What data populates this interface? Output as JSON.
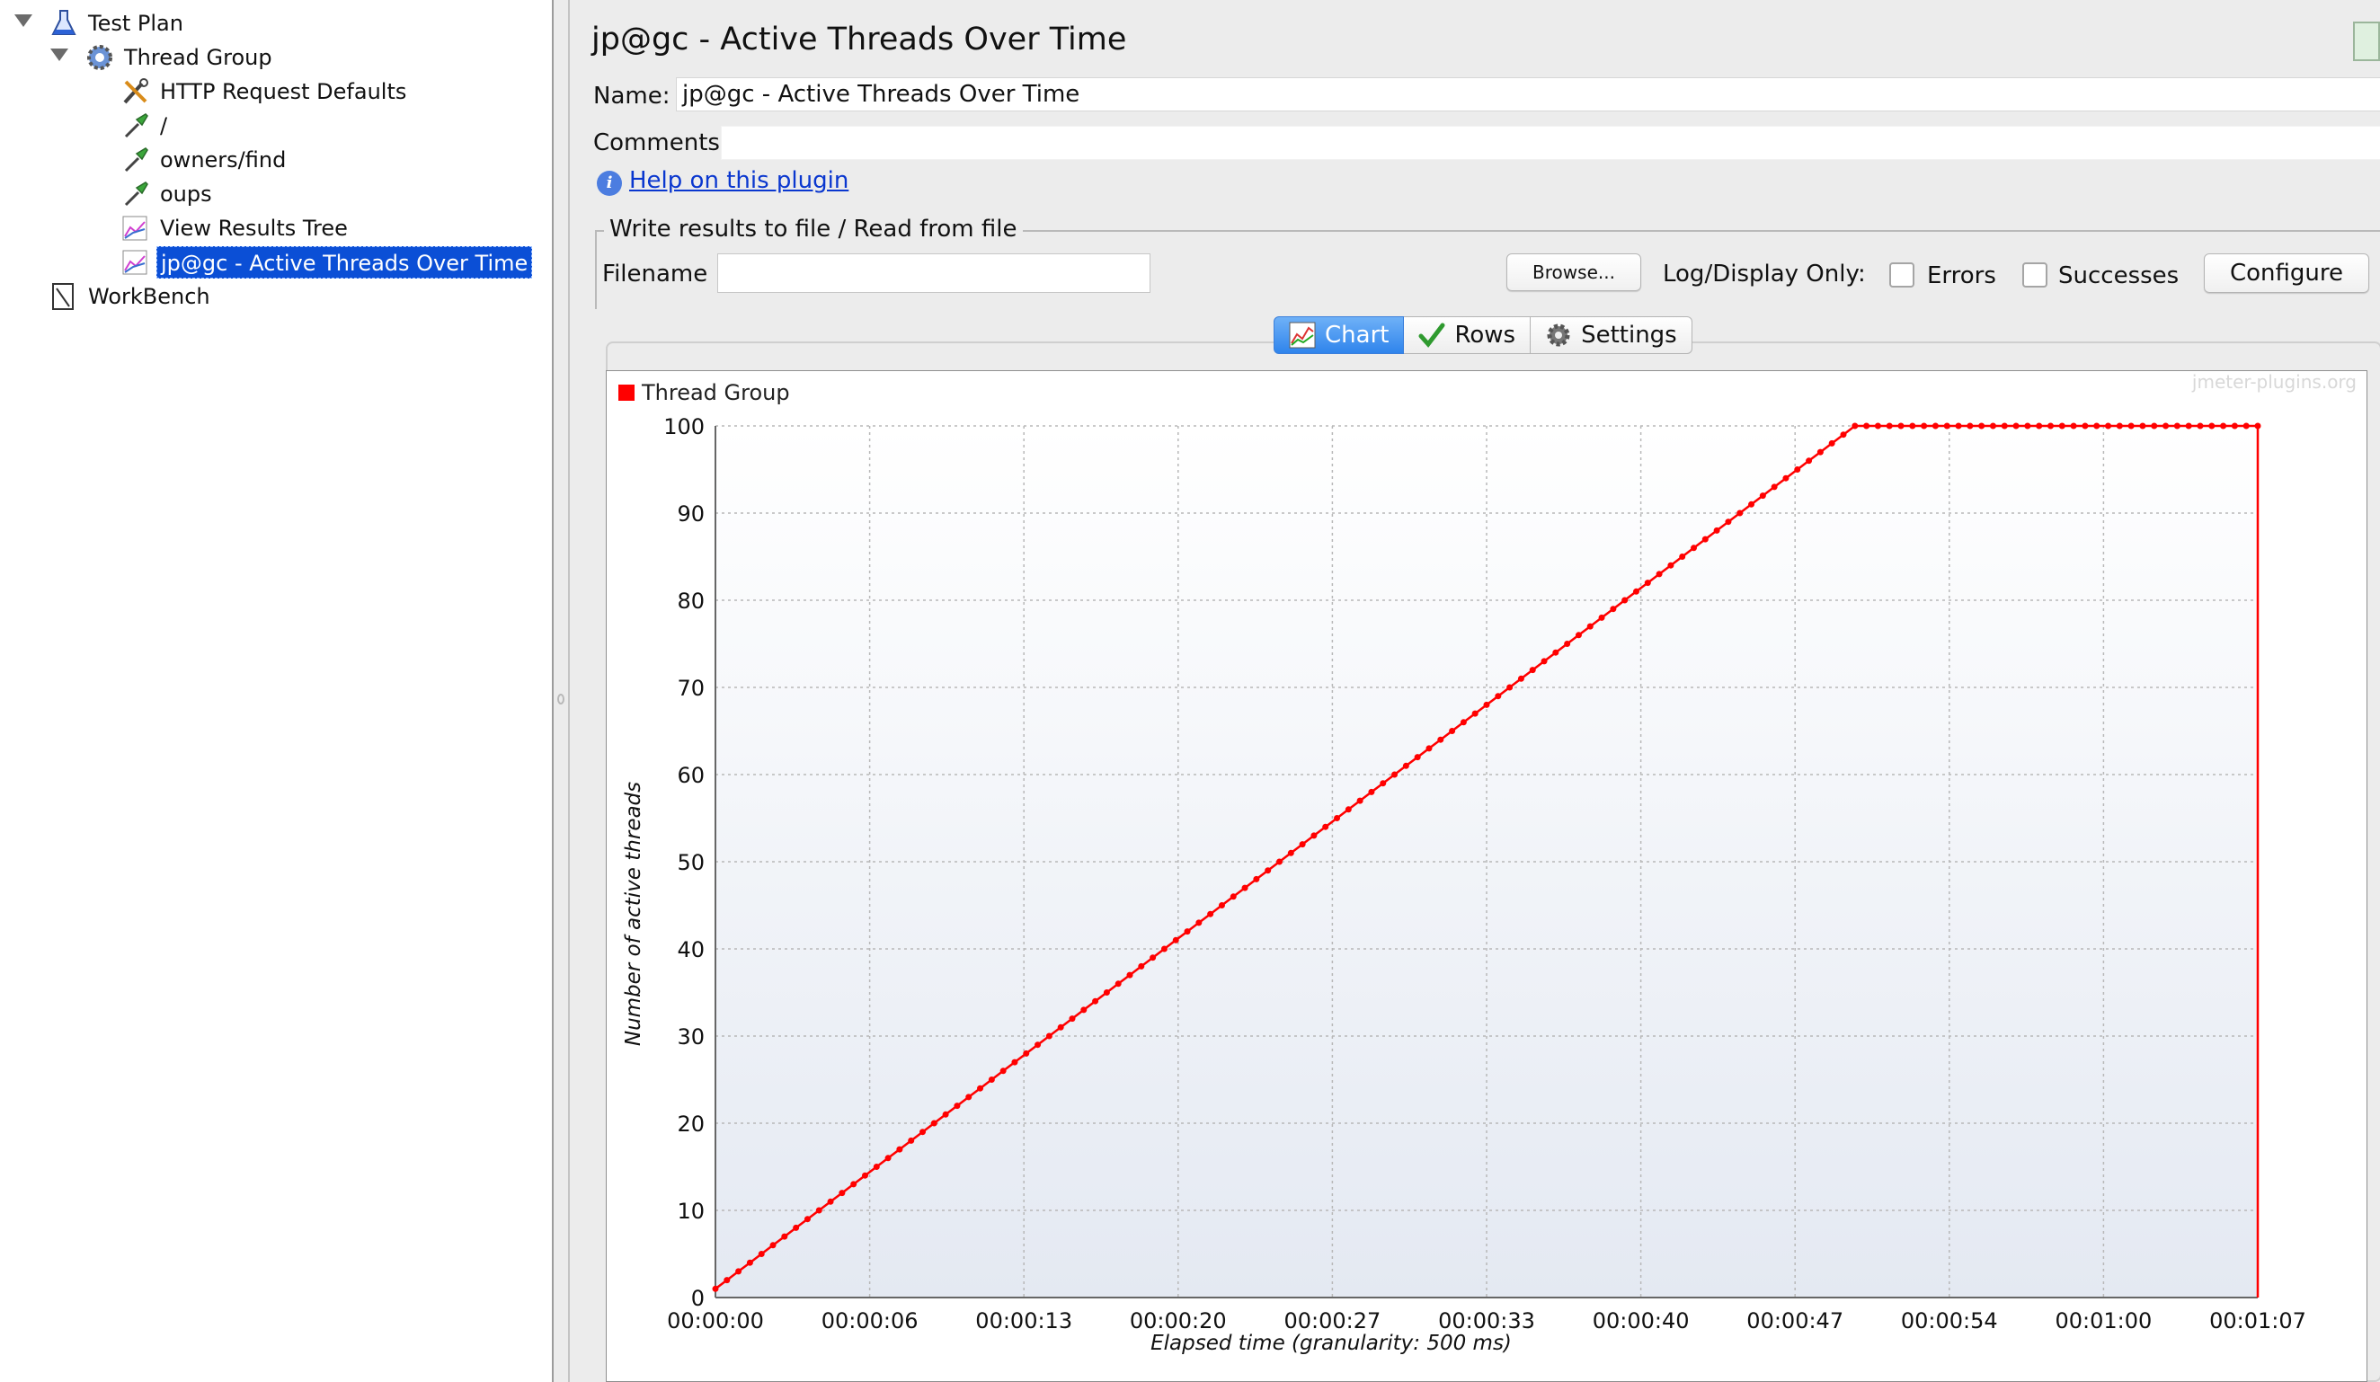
{
  "tree": {
    "items": [
      {
        "label": "Test Plan",
        "icon": "test-plan-flask-icon",
        "level": 0,
        "expanded": true
      },
      {
        "label": "Thread Group",
        "icon": "thread-group-gear-icon",
        "level": 1,
        "expanded": true
      },
      {
        "label": "HTTP Request Defaults",
        "icon": "config-tools-icon",
        "level": 2
      },
      {
        "label": "/",
        "icon": "http-sampler-pipette-icon",
        "level": 2
      },
      {
        "label": "owners/find",
        "icon": "http-sampler-pipette-icon",
        "level": 2
      },
      {
        "label": "oups",
        "icon": "http-sampler-pipette-icon",
        "level": 2
      },
      {
        "label": "View Results Tree",
        "icon": "listener-graph-icon",
        "level": 2
      },
      {
        "label": "jp@gc - Active Threads Over Time",
        "icon": "listener-graph-icon",
        "level": 2,
        "selected": true
      },
      {
        "label": "WorkBench",
        "icon": "workbench-icon",
        "level": 0
      }
    ]
  },
  "panel": {
    "title": "jp@gc - Active Threads Over Time",
    "name_label": "Name:",
    "name_value": "jp@gc - Active Threads Over Time",
    "comments_label": "Comments:",
    "comments_value": "",
    "help_link": "Help on this plugin"
  },
  "file_section": {
    "legend": "Write results to file / Read from file",
    "filename_label": "Filename",
    "filename_value": "",
    "browse_button": "Browse...",
    "log_display_label": "Log/Display Only:",
    "errors_label": "Errors",
    "errors_checked": false,
    "successes_label": "Successes",
    "successes_checked": false,
    "configure_button": "Configure"
  },
  "tabs": [
    {
      "label": "Chart",
      "icon": "chart-icon",
      "active": true
    },
    {
      "label": "Rows",
      "icon": "checkmark-icon",
      "active": false
    },
    {
      "label": "Settings",
      "icon": "gear-icon",
      "active": false
    }
  ],
  "colors": {
    "series": "#ff0000",
    "selection": "#0b4fd6",
    "active_tab": "#2f84ec"
  },
  "chart_data": {
    "type": "line",
    "title": "",
    "watermark": "jmeter-plugins.org",
    "xlabel": "Elapsed time (granularity: 500 ms)",
    "ylabel": "Number of active threads",
    "xlim": [
      0,
      67
    ],
    "ylim": [
      0,
      100
    ],
    "x_unit": "seconds",
    "x_ticks": [
      "00:00:00",
      "00:00:06",
      "00:00:13",
      "00:00:20",
      "00:00:27",
      "00:00:33",
      "00:00:40",
      "00:00:47",
      "00:00:54",
      "00:01:00",
      "00:01:07"
    ],
    "y_ticks": [
      0,
      10,
      20,
      30,
      40,
      50,
      60,
      70,
      80,
      90,
      100
    ],
    "grid": true,
    "legend_position": "top-left",
    "series": [
      {
        "name": "Thread Group",
        "color": "#ff0000",
        "x": [
          0,
          0.5,
          1,
          1.5,
          2,
          2.5,
          3,
          3.5,
          4,
          4.5,
          5,
          5.5,
          6,
          6.5,
          7,
          7.5,
          8,
          8.5,
          9,
          9.5,
          10,
          10.5,
          11,
          11.5,
          12,
          12.5,
          13,
          13.5,
          14,
          14.5,
          15,
          15.5,
          16,
          16.5,
          17,
          17.5,
          18,
          18.5,
          19,
          19.5,
          20,
          20.5,
          21,
          21.5,
          22,
          22.5,
          23,
          23.5,
          24,
          24.5,
          25,
          25.5,
          26,
          26.5,
          27,
          27.5,
          28,
          28.5,
          29,
          29.5,
          30,
          30.5,
          31,
          31.5,
          32,
          32.5,
          33,
          33.5,
          34,
          34.5,
          35,
          35.5,
          36,
          36.5,
          37,
          37.5,
          38,
          38.5,
          39,
          39.5,
          40,
          40.5,
          41,
          41.5,
          42,
          42.5,
          43,
          43.5,
          44,
          44.5,
          45,
          45.5,
          46,
          46.5,
          47,
          47.5,
          48,
          48.5,
          49,
          49.5,
          50,
          50.5,
          51,
          51.5,
          52,
          52.5,
          53,
          53.5,
          54,
          54.5,
          55,
          55.5,
          56,
          56.5,
          57,
          57.5,
          58,
          58.5,
          59,
          59.5,
          60,
          60.5,
          61,
          61.5,
          62,
          62.5,
          63,
          63.5,
          64,
          64.5,
          65,
          65.5,
          66,
          66.5,
          67,
          67
        ],
        "y": [
          1,
          2,
          3,
          4,
          5,
          6,
          7,
          8,
          9,
          10,
          11,
          12,
          13,
          14,
          15,
          16,
          17,
          18,
          19,
          20,
          21,
          22,
          23,
          24,
          25,
          26,
          27,
          28,
          29,
          30,
          31,
          32,
          33,
          34,
          35,
          36,
          37,
          38,
          39,
          40,
          41,
          42,
          43,
          44,
          45,
          46,
          47,
          48,
          49,
          50,
          51,
          52,
          53,
          54,
          55,
          56,
          57,
          58,
          59,
          60,
          61,
          62,
          63,
          64,
          65,
          66,
          67,
          68,
          69,
          70,
          71,
          72,
          73,
          74,
          75,
          76,
          77,
          78,
          79,
          80,
          81,
          82,
          83,
          84,
          85,
          86,
          87,
          88,
          89,
          90,
          91,
          92,
          93,
          94,
          95,
          96,
          97,
          98,
          99,
          100,
          100,
          100,
          100,
          100,
          100,
          100,
          100,
          100,
          100,
          100,
          100,
          100,
          100,
          100,
          100,
          100,
          100,
          100,
          100,
          100,
          100,
          100,
          100,
          100,
          100,
          100,
          100,
          100,
          100,
          100,
          100,
          100,
          100,
          100,
          100,
          0
        ]
      }
    ]
  }
}
